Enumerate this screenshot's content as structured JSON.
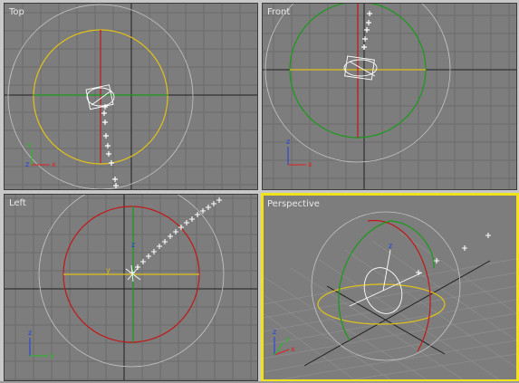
{
  "viewports": {
    "top": {
      "label": "Top"
    },
    "front": {
      "label": "Front"
    },
    "left": {
      "label": "Left"
    },
    "perspective": {
      "label": "Perspective",
      "active": true
    }
  },
  "axis_letters": {
    "x": "x",
    "y": "y",
    "z": "z"
  },
  "colors": {
    "viewport_bg": "#7d7d7d",
    "grid": "#6c6c6c",
    "grid_major": "#1e1e1e",
    "active_border": "#f2e21c",
    "ring_yellow": "#e0c21a",
    "ring_red": "#c01818",
    "ring_green": "#1a9a1a",
    "outer_sphere": "#c4c4c4",
    "axis_x": "#e02020",
    "axis_y": "#20c020",
    "axis_z": "#2040e0",
    "marker": "#ffffff"
  },
  "icons": {
    "gizmo": "rotate-gizmo-icon",
    "axis_tripod": "axis-tripod-icon",
    "keyframe_marker": "plus-marker-icon"
  }
}
